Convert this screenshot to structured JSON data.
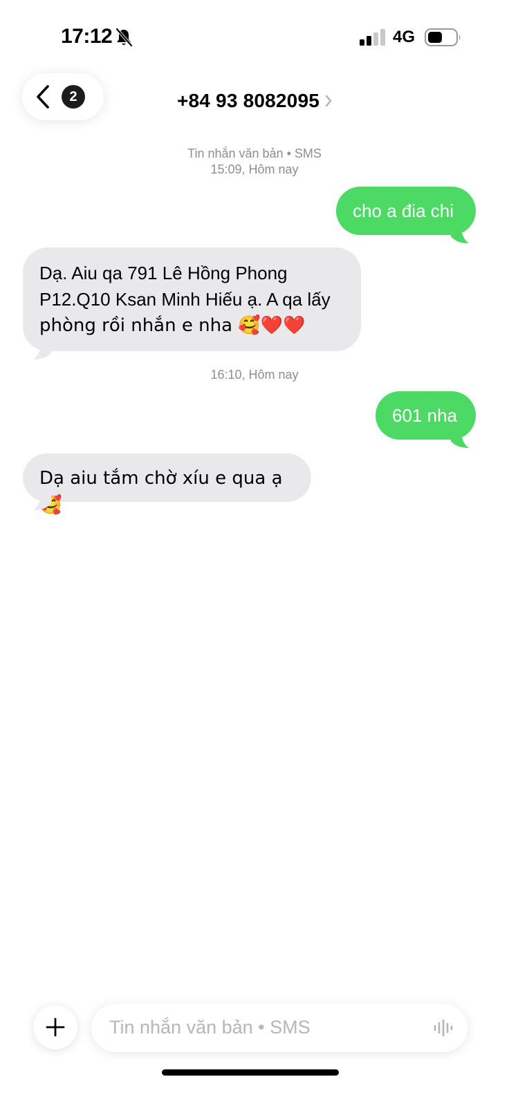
{
  "status_bar": {
    "time": "17:12",
    "network": "4G",
    "icons": [
      "bell-slash-icon",
      "cellular-signal-icon",
      "battery-icon"
    ]
  },
  "header": {
    "back_badge_count": "2",
    "contact": "+84 93 8082095",
    "icons": [
      "chevron-left-icon",
      "chevron-right-icon"
    ]
  },
  "thread": {
    "service_label": "Tin nhắn văn bản • SMS",
    "messages": [
      {
        "type": "timestamp",
        "text": "15:09, Hôm nay"
      },
      {
        "type": "outgoing",
        "text": "cho a đia chi"
      },
      {
        "type": "incoming",
        "lines": [
          "Dạ. Aiu qa 791 Lê Hồng Phong",
          "P12.Q10 Ksan Minh Hiếu ạ. A qa lấy",
          "phòng rồi nhắn e nha 🥰❤️❤️"
        ]
      },
      {
        "type": "timestamp",
        "text": "16:10, Hôm nay"
      },
      {
        "type": "outgoing",
        "text": "601 nha"
      },
      {
        "type": "incoming",
        "text": "Dạ aiu tắm chờ xíu e qua ạ 🥰"
      }
    ]
  },
  "composer": {
    "placeholder": "Tin nhắn văn bản • SMS",
    "icons": [
      "plus-icon",
      "waveform-icon"
    ]
  },
  "colors": {
    "outgoing_bubble": "#4cd964",
    "incoming_bubble": "#e9e9eb",
    "meta_text": "#8e8e93"
  }
}
